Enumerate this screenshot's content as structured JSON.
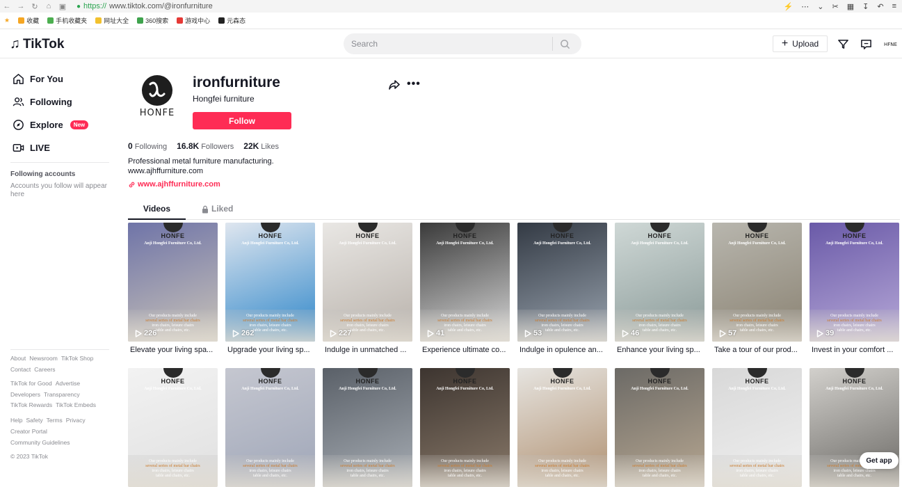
{
  "browser": {
    "url_protocol": "https://",
    "url_rest": "www.tiktok.com/@ironfurniture",
    "bookmarks": [
      {
        "label": "收藏",
        "color": "#f5a623"
      },
      {
        "label": "手机收藏夹",
        "color": "#4caf50"
      },
      {
        "label": "网址大全",
        "color": "#f2c12e"
      },
      {
        "label": "360搜索",
        "color": "#3fa34d"
      },
      {
        "label": "游戏中心",
        "color": "#e53935"
      },
      {
        "label": "元森态",
        "color": "#222222"
      }
    ]
  },
  "header": {
    "logo_text": "TikTok",
    "search_placeholder": "Search",
    "upload_label": "Upload"
  },
  "sidebar": {
    "nav": [
      {
        "label": "For You",
        "icon": "home-icon"
      },
      {
        "label": "Following",
        "icon": "people-icon"
      },
      {
        "label": "Explore",
        "icon": "compass-icon",
        "badge": "New"
      },
      {
        "label": "LIVE",
        "icon": "live-icon"
      }
    ],
    "following_title": "Following accounts",
    "following_empty": "Accounts you follow will appear here",
    "footer_rows": [
      [
        "About",
        "Newsroom",
        "TikTok Shop"
      ],
      [
        "Contact",
        "Careers"
      ],
      [
        "TikTok for Good",
        "Advertise"
      ],
      [
        "Developers",
        "Transparency"
      ],
      [
        "TikTok Rewards",
        "TikTok Embeds"
      ],
      [
        "Help",
        "Safety",
        "Terms",
        "Privacy"
      ],
      [
        "Creator Portal"
      ],
      [
        "Community Guidelines"
      ],
      [
        "© 2023 TikTok"
      ]
    ]
  },
  "profile": {
    "avatar_text": "HONFE",
    "username": "ironfurniture",
    "nickname": "Hongfei furniture",
    "follow_label": "Follow",
    "stats": [
      {
        "value": "0",
        "label": "Following"
      },
      {
        "value": "16.8K",
        "label": "Followers"
      },
      {
        "value": "22K",
        "label": "Likes"
      }
    ],
    "bio_line1": "Professional metal furniture manufacturing.",
    "bio_line2": "www.ajhffurniture.com",
    "link": "www.ajhffurniture.com",
    "tabs": {
      "videos": "Videos",
      "liked": "Liked"
    }
  },
  "video_overlay": {
    "brand": "HONFE",
    "company": "Anji Hongfei Furniture Co, Ltd.",
    "text1": "Our products mainly include",
    "text2": "several series of metal bar chairs",
    "text3": "iron chairs, leisure chairs",
    "text4": "table and chairs, etc."
  },
  "videos": [
    {
      "views": "226",
      "title": "Elevate your living spa...",
      "colors": [
        "#6f74a8",
        "#c9c3b8"
      ]
    },
    {
      "views": "262",
      "title": "Upgrade your living sp...",
      "colors": [
        "#dfe6ef",
        "#2e86c9"
      ]
    },
    {
      "views": "227",
      "title": "Indulge in unmatched ...",
      "colors": [
        "#e9e7e4",
        "#b8b1aa"
      ]
    },
    {
      "views": "41",
      "title": "Experience ultimate co...",
      "colors": [
        "#3a3a3a",
        "#d8d8d8"
      ]
    },
    {
      "views": "53",
      "title": "Indulge in opulence an...",
      "colors": [
        "#333a44",
        "#9aa4b0"
      ]
    },
    {
      "views": "46",
      "title": "Enhance your living sp...",
      "colors": [
        "#cfd8d6",
        "#8a9a98"
      ]
    },
    {
      "views": "57",
      "title": "Take a tour of our prod...",
      "colors": [
        "#b8b6ae",
        "#8a8272"
      ]
    },
    {
      "views": "39",
      "title": "Invest in your comfort ...",
      "colors": [
        "#6a5aa8",
        "#b7a9d8"
      ]
    },
    {
      "views": "",
      "title": "",
      "colors": [
        "#f2f2f2",
        "#e0e0e0"
      ]
    },
    {
      "views": "",
      "title": "",
      "colors": [
        "#c5c7d0",
        "#9fa6b8"
      ]
    },
    {
      "views": "",
      "title": "",
      "colors": [
        "#5a6068",
        "#a8aeb5"
      ]
    },
    {
      "views": "",
      "title": "",
      "colors": [
        "#3d3530",
        "#8a7a6a"
      ]
    },
    {
      "views": "",
      "title": "",
      "colors": [
        "#e6e4e0",
        "#b09070"
      ]
    },
    {
      "views": "",
      "title": "",
      "colors": [
        "#6c6a66",
        "#b8a892"
      ]
    },
    {
      "views": "",
      "title": "",
      "colors": [
        "#d8d8d8",
        "#f0f0f0"
      ]
    },
    {
      "views": "",
      "title": "",
      "colors": [
        "#d2d0cc",
        "#6a6864"
      ]
    }
  ],
  "get_app": "Get app"
}
